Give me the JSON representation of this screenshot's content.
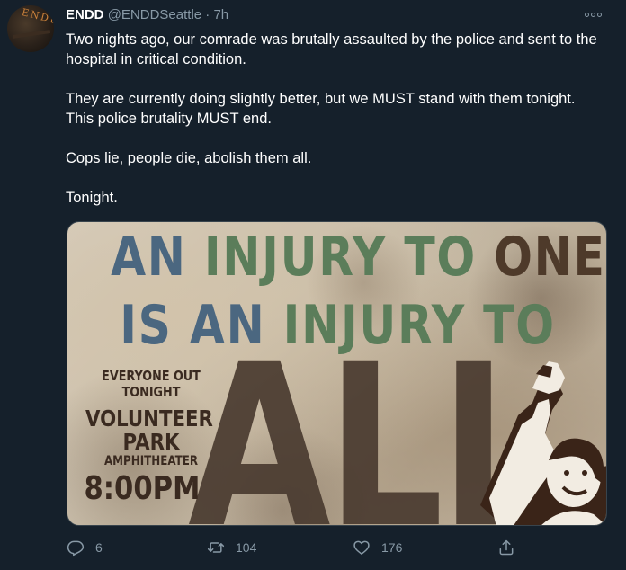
{
  "tweet": {
    "display_name": "ENDD",
    "handle": "@ENDDSeattle",
    "separator": "·",
    "time": "7h",
    "paragraphs": [
      "Two nights ago, our comrade was brutally assaulted by the police and sent to the hospital in critical condition.",
      "They are currently doing slightly better, but we MUST stand with them tonight. This police brutality MUST end.",
      "Cops lie, people die, abolish them all.",
      "Tonight."
    ],
    "avatar_text": "ENDD"
  },
  "poster": {
    "line1": [
      "AN",
      "INJURY",
      "TO",
      "ONE"
    ],
    "line2": [
      "IS",
      "AN",
      "INJURY",
      "TO"
    ],
    "big_word": "ALL",
    "event": {
      "everyone_out": "EVERYONE OUT",
      "tonight": "TONIGHT",
      "venue_1": "VOLUNTEER",
      "venue_2": "PARK",
      "venue_3": "AMPHITHEATER",
      "time": "8:00PM"
    }
  },
  "actions": {
    "reply_count": "6",
    "retweet_count": "104",
    "like_count": "176"
  },
  "icons": [
    "reply-icon",
    "retweet-icon",
    "like-icon",
    "share-icon",
    "more-options-icon"
  ],
  "colors": {
    "background": "#15202b",
    "secondary_text": "#8899a6"
  }
}
